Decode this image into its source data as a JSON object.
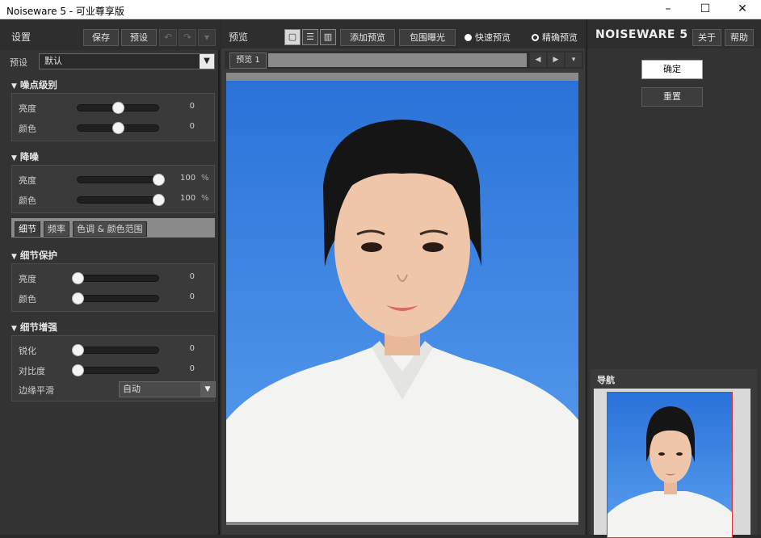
{
  "window": {
    "title": "Noiseware 5 - 可业尊享版",
    "min": "–",
    "max": "☐",
    "close": "✕"
  },
  "settings": {
    "title": "设置",
    "save": "保存",
    "preset_btn": "预设",
    "undo": "↶",
    "redo": "↷",
    "more": "▾",
    "preset_label": "预设",
    "preset_value": "默认",
    "noise_level": {
      "title": "噪点级别",
      "rows": [
        {
          "label": "亮度",
          "value": "0",
          "level": 0.5
        },
        {
          "label": "颜色",
          "value": "0",
          "level": 0.5
        }
      ]
    },
    "noise_reduction": {
      "title": "降噪",
      "rows": [
        {
          "label": "亮度",
          "value": "100",
          "unit": "%",
          "level": 1.0
        },
        {
          "label": "颜色",
          "value": "100",
          "unit": "%",
          "level": 1.0
        }
      ]
    },
    "tabs": [
      "细节",
      "频率",
      "色调 & 颜色范围"
    ],
    "detail_protect": {
      "title": "细节保护",
      "rows": [
        {
          "label": "亮度",
          "value": "0",
          "level": 0
        },
        {
          "label": "颜色",
          "value": "0",
          "level": 0
        }
      ]
    },
    "detail_enhance": {
      "title": "细节增强",
      "rows": [
        {
          "label": "锐化",
          "value": "0",
          "level": 0
        },
        {
          "label": "对比度",
          "value": "0",
          "level": 0
        }
      ],
      "edge_label": "边缘平滑",
      "edge_value": "自动"
    }
  },
  "preview": {
    "title": "预览",
    "add_preview": "添加预览",
    "bracket": "包围曝光",
    "fast_preview": "快速预览",
    "exact_preview": "精确预览",
    "tab": "预览 1",
    "prev": "◀",
    "next": "▶",
    "menu": "▾"
  },
  "right": {
    "brand": "NOISEWARE 5",
    "about": "关于",
    "help": "帮助",
    "ok": "确定",
    "reset": "重置",
    "navigator": "导航"
  },
  "colors": {
    "sky": "#2a72d8",
    "panel": "#333333",
    "nav_frame": "#e03030"
  }
}
